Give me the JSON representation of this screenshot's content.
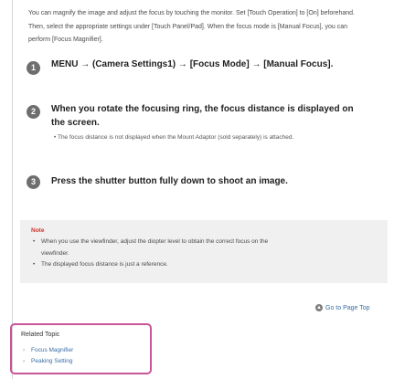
{
  "intro": "You can magnify the image and adjust the focus by touching the monitor. Set [Touch Operation] to [On] beforehand. Then, select the appropriate settings under [Touch Panel/Pad]. When the focus mode is [Manual Focus], you can perform [Focus Magnifier].",
  "steps": [
    {
      "num": "1",
      "text": "MENU → (Camera Settings1) → [Focus Mode] → [Manual Focus]."
    },
    {
      "num": "2",
      "text": "When you rotate the focusing ring, the focus distance is displayed on the screen.",
      "note": "The focus distance is not displayed when the Mount Adaptor (sold separately) is attached."
    },
    {
      "num": "3",
      "text": "Press the shutter button fully down to shoot an image."
    }
  ],
  "note_box": {
    "title": "Note",
    "items": [
      "When you use the viewfinder, adjust the diopter level to obtain the correct focus on the",
      "viewfinder.",
      "The displayed focus distance is just a reference."
    ]
  },
  "go_to_top": "Go to Page Top",
  "related": {
    "title": "Related Topic",
    "links": [
      "Focus Magnifier",
      "Peaking Setting"
    ]
  },
  "colors": {
    "accent_border": "#c8549a",
    "note_title": "#d0342c",
    "link": "#3a6ea5"
  },
  "icons": {
    "step_marker": "numbered-circle-icon",
    "top_link": "up-arrow-icon"
  }
}
